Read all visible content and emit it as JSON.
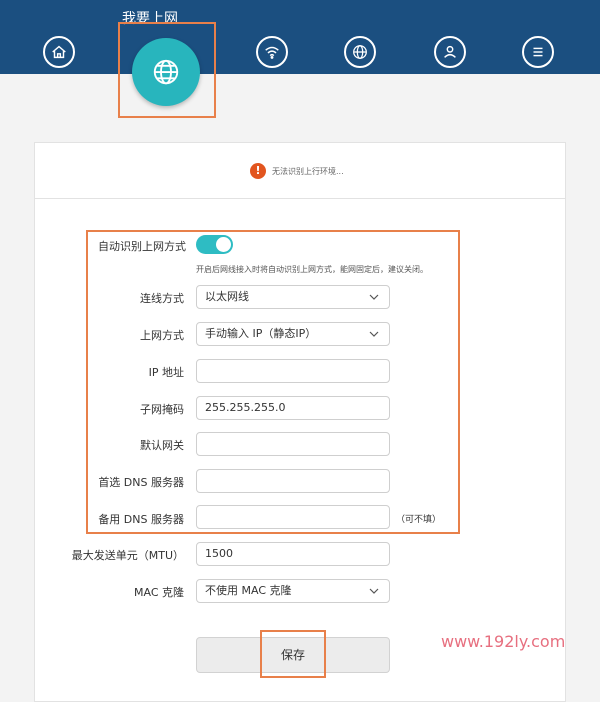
{
  "nav": {
    "title": "我要上网",
    "icons": [
      "home-icon",
      "globe-icon",
      "wifi-icon",
      "globe-settings-icon",
      "user-icon",
      "menu-icon"
    ]
  },
  "status": {
    "icon": "!",
    "text": "无法识别上行环境..."
  },
  "form": {
    "auto_detect_label": "自动识别上网方式",
    "auto_detect_on": true,
    "hint": "开启后网线接入时将自动识别上网方式，能网固定后，建议关闭。",
    "connection_label": "连线方式",
    "connection_value": "以太网线",
    "method_label": "上网方式",
    "method_value": "手动输入 IP（静态IP）",
    "ip_label": "IP 地址",
    "ip_value": "",
    "mask_label": "子网掩码",
    "mask_value": "255.255.255.0",
    "gateway_label": "默认网关",
    "gateway_value": "",
    "dns1_label": "首选 DNS 服务器",
    "dns1_value": "",
    "dns2_label": "备用 DNS 服务器",
    "dns2_value": "",
    "dns2_optional": "（可不填）",
    "mtu_label": "最大发送单元（MTU）",
    "mtu_value": "1500",
    "mac_label": "MAC 克隆",
    "mac_value": "不使用 MAC 克隆",
    "save_label": "保存"
  },
  "watermark": "www.192ly.com",
  "colors": {
    "topbar": "#1b4f80",
    "accent": "#28b5bd",
    "highlight": "#e8804a",
    "alert": "#e2551f"
  }
}
